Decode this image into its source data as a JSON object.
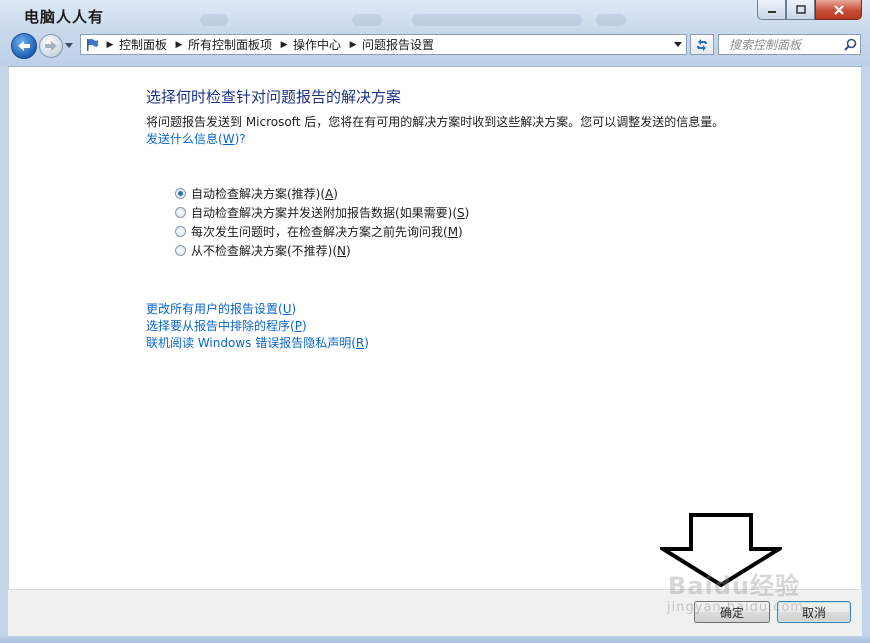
{
  "window": {
    "title_overlay": "电脑人人有"
  },
  "nav": {
    "breadcrumbs": [
      "控制面板",
      "所有控制面板项",
      "操作中心",
      "问题报告设置"
    ]
  },
  "search": {
    "placeholder": "搜索控制面板"
  },
  "main": {
    "heading": "选择何时检查针对问题报告的解决方案",
    "description": "将问题报告发送到 Microsoft 后，您将在有可用的解决方案时收到这些解决方案。您可以调整发送的信息量。",
    "what_link": {
      "text": "发送什么信息(",
      "key": "W",
      "suffix": ")?"
    },
    "radio_options": [
      {
        "text": "自动检查解决方案(推荐)(",
        "key": "A",
        "suffix": ")",
        "selected": true
      },
      {
        "text": "自动检查解决方案并发送附加报告数据(如果需要)(",
        "key": "S",
        "suffix": ")",
        "selected": false
      },
      {
        "text": "每次发生问题时，在检查解决方案之前先询问我(",
        "key": "M",
        "suffix": ")",
        "selected": false
      },
      {
        "text": "从不检查解决方案(不推荐)(",
        "key": "N",
        "suffix": ")",
        "selected": false
      }
    ],
    "links": [
      {
        "text": "更改所有用户的报告设置(",
        "key": "U",
        "suffix": ")"
      },
      {
        "text": "选择要从报告中排除的程序(",
        "key": "P",
        "suffix": ")"
      },
      {
        "text": "联机阅读 Windows 错误报告隐私声明(",
        "key": "R",
        "suffix": ")"
      }
    ]
  },
  "footer": {
    "ok_label": "确定",
    "cancel_label": "取消"
  },
  "overlay": {
    "watermark": "Baidu经验",
    "watermark_url": "jingyan.baidu.com"
  },
  "colors": {
    "link": "#0a66cc",
    "heading": "#1e3287",
    "glass": "#c9d9ec"
  },
  "icons": [
    "back-arrow-icon",
    "forward-arrow-icon",
    "dropdown-icon",
    "flag-icon",
    "refresh-icon",
    "search-icon",
    "minimize-icon",
    "maximize-icon",
    "close-icon",
    "down-arrow-annotation"
  ]
}
